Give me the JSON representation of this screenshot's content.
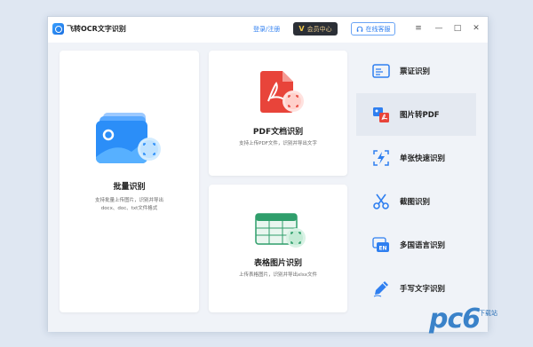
{
  "titlebar": {
    "app_title": "飞转OCR文字识别",
    "login": "登录/注册",
    "vip": "会员中心",
    "vip_icon": "V",
    "service": "在线客服",
    "menu_icon": "≡",
    "minimize_icon": "—",
    "maximize_icon": "□",
    "close_icon": "✕"
  },
  "cards": {
    "batch": {
      "title": "批量识别",
      "desc_line1": "支持批量上传图片，识别并导出",
      "desc_line2": "docx、doc、txt文件格式"
    },
    "pdf": {
      "title": "PDF文档识别",
      "desc": "支持上传PDF文件，识别并导出文字"
    },
    "table": {
      "title": "表格图片识别",
      "desc": "上传表格图片，识别并导出xlsx文件"
    }
  },
  "sidebar": {
    "items": [
      {
        "label": "票证识别",
        "icon": "id-card-icon"
      },
      {
        "label": "图片转PDF",
        "icon": "image-to-pdf-icon"
      },
      {
        "label": "单张快速识别",
        "icon": "lightning-scan-icon"
      },
      {
        "label": "截图识别",
        "icon": "scissors-icon"
      },
      {
        "label": "多国语言识别",
        "icon": "language-en-icon"
      },
      {
        "label": "手写文字识别",
        "icon": "handwriting-pen-icon"
      }
    ]
  },
  "watermark": {
    "text": "pc6",
    "subtext": "下载站"
  },
  "colors": {
    "accent": "#2f7ff0",
    "pdf_red": "#e8443a",
    "table_green": "#2f9e6b",
    "panel_bg": "#f0f3f8"
  }
}
